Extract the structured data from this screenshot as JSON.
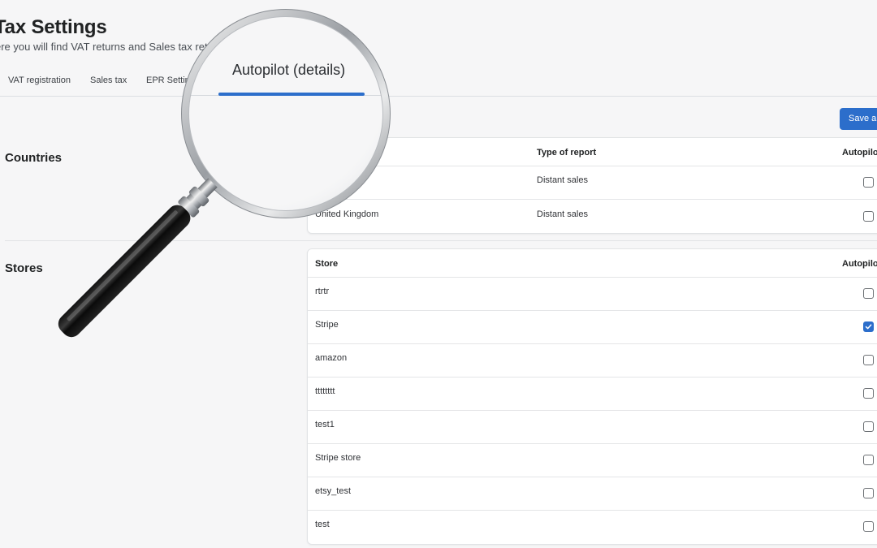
{
  "page": {
    "title": "Tax Settings",
    "subtitle": "ere you will find VAT returns and Sales tax returns"
  },
  "tabs": [
    {
      "label": "VAT registration"
    },
    {
      "label": "Sales tax"
    },
    {
      "label": "EPR Setting"
    },
    {
      "label": "Autopilot (details)",
      "active": true
    }
  ],
  "toolbar": {
    "save_label": "Save al"
  },
  "countries_section": {
    "heading": "Countries",
    "columns": {
      "type": "Type of report",
      "autopilot": "Autopilot"
    },
    "rows": [
      {
        "country": "",
        "type": "Distant sales",
        "checked": false
      },
      {
        "country": "United Kingdom",
        "type": "Distant sales",
        "checked": false
      }
    ]
  },
  "stores_section": {
    "heading": "Stores",
    "columns": {
      "store": "Store",
      "autopilot": "Autopilot"
    },
    "rows": [
      {
        "store": "rtrtr",
        "checked": false
      },
      {
        "store": "Stripe",
        "checked": true
      },
      {
        "store": "amazon",
        "checked": false
      },
      {
        "store": "tttttttt",
        "checked": false
      },
      {
        "store": "test1",
        "checked": false
      },
      {
        "store": "Stripe store",
        "checked": false
      },
      {
        "store": "etsy_test",
        "checked": false
      },
      {
        "store": "test",
        "checked": false
      }
    ]
  },
  "colors": {
    "accent": "#2c6ecb",
    "background": "#f6f6f7"
  },
  "icons": {
    "magnifier": "magnifying-glass-icon",
    "check": "checkmark-icon"
  }
}
